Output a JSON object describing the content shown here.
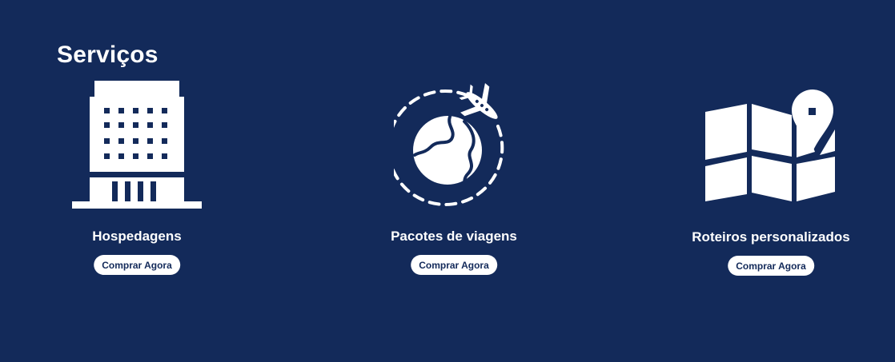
{
  "services": {
    "title": "Serviços",
    "items": [
      {
        "name": "Hospedagens",
        "button_label": "Comprar Agora",
        "icon": "hotel-building-icon"
      },
      {
        "name": "Pacotes de viagens",
        "button_label": "Comprar Agora",
        "icon": "globe-airplane-icon"
      },
      {
        "name": "Roteiros personalizados",
        "button_label": "Comprar Agora",
        "icon": "map-pin-icon"
      }
    ]
  },
  "colors": {
    "background": "#132a5a",
    "foreground": "#ffffff",
    "button_text": "#132a5a"
  }
}
